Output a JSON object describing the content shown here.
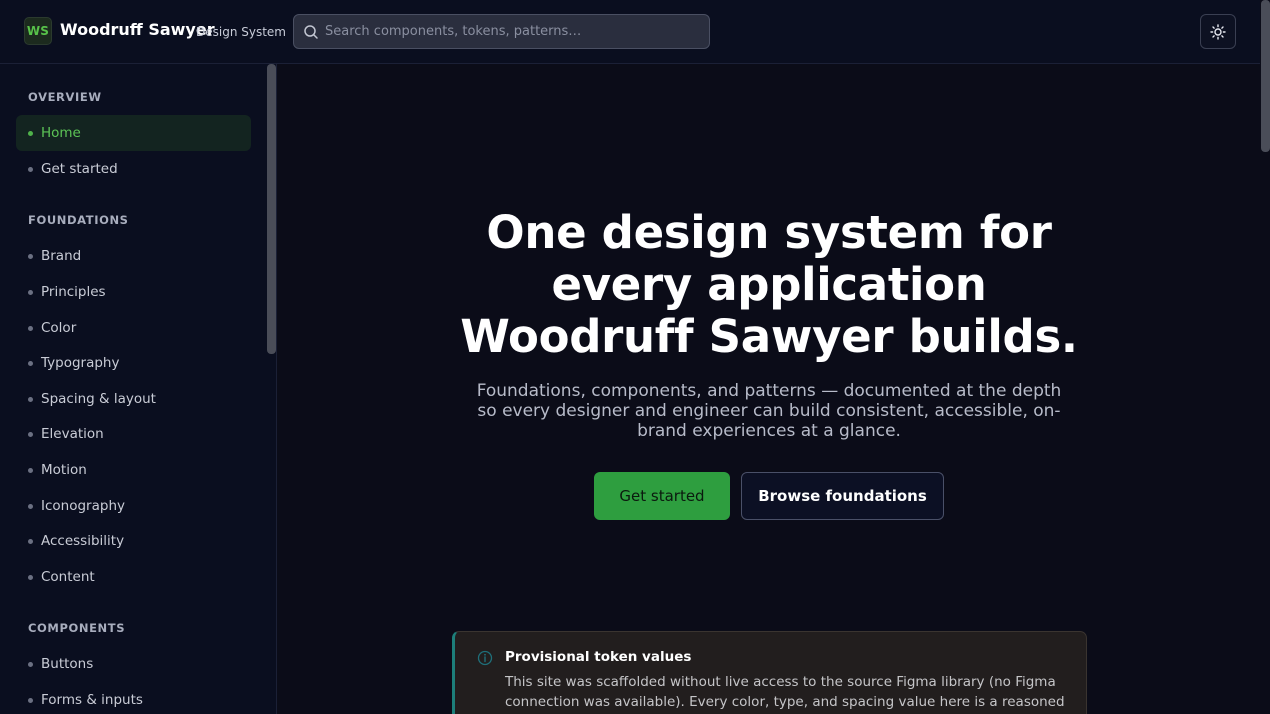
{
  "header": {
    "logo_text": "WS",
    "brand_name": "Woodruff Sawyer",
    "brand_sub": "Design System",
    "search_placeholder": "Search components, tokens, patterns…",
    "theme_toggle_icon": "sun-icon"
  },
  "sidebar": {
    "sections": [
      {
        "title": "OVERVIEW",
        "items": [
          "Home",
          "Get started"
        ]
      },
      {
        "title": "FOUNDATIONS",
        "items": [
          "Brand",
          "Principles",
          "Color",
          "Typography",
          "Spacing & layout",
          "Elevation",
          "Motion",
          "Iconography",
          "Accessibility",
          "Content"
        ]
      },
      {
        "title": "COMPONENTS",
        "items": [
          "Buttons",
          "Forms & inputs"
        ]
      }
    ],
    "active_item": "Home"
  },
  "hero": {
    "title": "One design system for every application Woodruff Sawyer builds.",
    "subtitle": "Foundations, components, and patterns — documented at the depth so every designer and engineer can build consistent, accessible, on-brand experiences at a glance.",
    "primary_button": "Get started",
    "secondary_button": "Browse foundations"
  },
  "callout": {
    "icon": "info-icon",
    "title": "Provisional token values",
    "body": "This site was scaffolded without live access to the source Figma library (no Figma connection was available). Every color, type, and spacing value here is a reasoned"
  },
  "colors": {
    "accent": "#2e9e3f",
    "active_nav_text": "#5cc456",
    "background": "#0b0c18",
    "callout_border": "#1d7f7a"
  }
}
